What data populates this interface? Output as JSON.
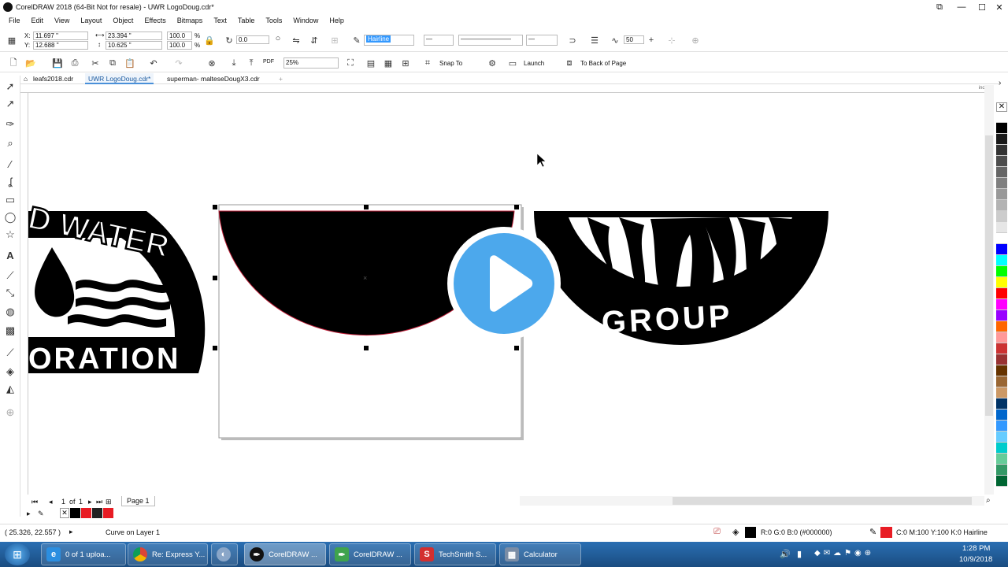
{
  "window": {
    "title": "CorelDRAW 2018 (64-Bit Not for resale) - UWR LogoDoug.cdr*"
  },
  "menu": [
    "File",
    "Edit",
    "View",
    "Layout",
    "Object",
    "Effects",
    "Bitmaps",
    "Text",
    "Table",
    "Tools",
    "Window",
    "Help"
  ],
  "propbar": {
    "x": "11.697 \"",
    "y": "12.688 \"",
    "w": "23.394 \"",
    "h": "10.625 \"",
    "scale_w": "100.0",
    "scale_h": "100.0",
    "pct": "%",
    "angle": "0.0",
    "outline": "Hairline",
    "smooth": "50"
  },
  "stdbar": {
    "zoom": "25%",
    "snap": "Snap To",
    "launch": "Launch",
    "back_of_page": "To Back of Page",
    "pdf": "PDF"
  },
  "tabs": [
    "leafs2018.cdr",
    "UWR LogoDoug.cdr*",
    "superman- malteseDougX3.cdr"
  ],
  "ruler": {
    "unit": "inches"
  },
  "logos": {
    "left_top": "D WATER",
    "left_bottom": "ORATION",
    "right_bottom": "GROUP"
  },
  "pagenav": {
    "current": "1",
    "of": "of",
    "total": "1",
    "page_tab": "Page 1"
  },
  "status": {
    "coords": "( 25.326, 22.557 )",
    "object": "Curve on Layer 1",
    "fill": "R:0 G:0 B:0 (#000000)",
    "outline": "C:0 M:100 Y:100 K:0  Hairline"
  },
  "palette": [
    "#ffffff",
    "#000000",
    "#1a1a1a",
    "#333333",
    "#4d4d4d",
    "#666666",
    "#808080",
    "#999999",
    "#b3b3b3",
    "#cccccc",
    "#e6e6e6",
    "#ffffff",
    "#0000ff",
    "#00ffff",
    "#00ff00",
    "#ffff00",
    "#ff0000",
    "#ff00ff",
    "#9900ff",
    "#ff6600",
    "#ff9999",
    "#cc3333",
    "#993333",
    "#663300",
    "#996633",
    "#cc9966",
    "#003366",
    "#0066cc",
    "#3399ff",
    "#66ccff",
    "#00cccc",
    "#66cc99",
    "#339966",
    "#006633"
  ],
  "taskbar": {
    "items": [
      "0 of 1 uploa...",
      "Re: Express Y...",
      "CorelDRAW ...",
      "CorelDRAW ...",
      "TechSmith S...",
      "Calculator"
    ],
    "time": "1:28 PM",
    "date": "10/9/2018"
  },
  "colors": {
    "accent": "#4ca8ec",
    "taskbar": "#1f5a96",
    "selection": "#000000"
  }
}
